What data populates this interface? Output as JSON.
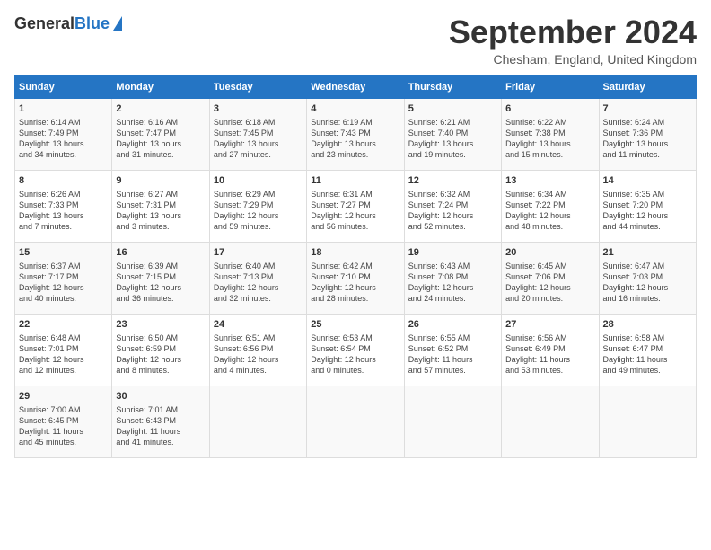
{
  "header": {
    "logo_general": "General",
    "logo_blue": "Blue",
    "month_title": "September 2024",
    "location": "Chesham, England, United Kingdom"
  },
  "days_of_week": [
    "Sunday",
    "Monday",
    "Tuesday",
    "Wednesday",
    "Thursday",
    "Friday",
    "Saturday"
  ],
  "weeks": [
    [
      {
        "day": "1",
        "info": "Sunrise: 6:14 AM\nSunset: 7:49 PM\nDaylight: 13 hours\nand 34 minutes."
      },
      {
        "day": "2",
        "info": "Sunrise: 6:16 AM\nSunset: 7:47 PM\nDaylight: 13 hours\nand 31 minutes."
      },
      {
        "day": "3",
        "info": "Sunrise: 6:18 AM\nSunset: 7:45 PM\nDaylight: 13 hours\nand 27 minutes."
      },
      {
        "day": "4",
        "info": "Sunrise: 6:19 AM\nSunset: 7:43 PM\nDaylight: 13 hours\nand 23 minutes."
      },
      {
        "day": "5",
        "info": "Sunrise: 6:21 AM\nSunset: 7:40 PM\nDaylight: 13 hours\nand 19 minutes."
      },
      {
        "day": "6",
        "info": "Sunrise: 6:22 AM\nSunset: 7:38 PM\nDaylight: 13 hours\nand 15 minutes."
      },
      {
        "day": "7",
        "info": "Sunrise: 6:24 AM\nSunset: 7:36 PM\nDaylight: 13 hours\nand 11 minutes."
      }
    ],
    [
      {
        "day": "8",
        "info": "Sunrise: 6:26 AM\nSunset: 7:33 PM\nDaylight: 13 hours\nand 7 minutes."
      },
      {
        "day": "9",
        "info": "Sunrise: 6:27 AM\nSunset: 7:31 PM\nDaylight: 13 hours\nand 3 minutes."
      },
      {
        "day": "10",
        "info": "Sunrise: 6:29 AM\nSunset: 7:29 PM\nDaylight: 12 hours\nand 59 minutes."
      },
      {
        "day": "11",
        "info": "Sunrise: 6:31 AM\nSunset: 7:27 PM\nDaylight: 12 hours\nand 56 minutes."
      },
      {
        "day": "12",
        "info": "Sunrise: 6:32 AM\nSunset: 7:24 PM\nDaylight: 12 hours\nand 52 minutes."
      },
      {
        "day": "13",
        "info": "Sunrise: 6:34 AM\nSunset: 7:22 PM\nDaylight: 12 hours\nand 48 minutes."
      },
      {
        "day": "14",
        "info": "Sunrise: 6:35 AM\nSunset: 7:20 PM\nDaylight: 12 hours\nand 44 minutes."
      }
    ],
    [
      {
        "day": "15",
        "info": "Sunrise: 6:37 AM\nSunset: 7:17 PM\nDaylight: 12 hours\nand 40 minutes."
      },
      {
        "day": "16",
        "info": "Sunrise: 6:39 AM\nSunset: 7:15 PM\nDaylight: 12 hours\nand 36 minutes."
      },
      {
        "day": "17",
        "info": "Sunrise: 6:40 AM\nSunset: 7:13 PM\nDaylight: 12 hours\nand 32 minutes."
      },
      {
        "day": "18",
        "info": "Sunrise: 6:42 AM\nSunset: 7:10 PM\nDaylight: 12 hours\nand 28 minutes."
      },
      {
        "day": "19",
        "info": "Sunrise: 6:43 AM\nSunset: 7:08 PM\nDaylight: 12 hours\nand 24 minutes."
      },
      {
        "day": "20",
        "info": "Sunrise: 6:45 AM\nSunset: 7:06 PM\nDaylight: 12 hours\nand 20 minutes."
      },
      {
        "day": "21",
        "info": "Sunrise: 6:47 AM\nSunset: 7:03 PM\nDaylight: 12 hours\nand 16 minutes."
      }
    ],
    [
      {
        "day": "22",
        "info": "Sunrise: 6:48 AM\nSunset: 7:01 PM\nDaylight: 12 hours\nand 12 minutes."
      },
      {
        "day": "23",
        "info": "Sunrise: 6:50 AM\nSunset: 6:59 PM\nDaylight: 12 hours\nand 8 minutes."
      },
      {
        "day": "24",
        "info": "Sunrise: 6:51 AM\nSunset: 6:56 PM\nDaylight: 12 hours\nand 4 minutes."
      },
      {
        "day": "25",
        "info": "Sunrise: 6:53 AM\nSunset: 6:54 PM\nDaylight: 12 hours\nand 0 minutes."
      },
      {
        "day": "26",
        "info": "Sunrise: 6:55 AM\nSunset: 6:52 PM\nDaylight: 11 hours\nand 57 minutes."
      },
      {
        "day": "27",
        "info": "Sunrise: 6:56 AM\nSunset: 6:49 PM\nDaylight: 11 hours\nand 53 minutes."
      },
      {
        "day": "28",
        "info": "Sunrise: 6:58 AM\nSunset: 6:47 PM\nDaylight: 11 hours\nand 49 minutes."
      }
    ],
    [
      {
        "day": "29",
        "info": "Sunrise: 7:00 AM\nSunset: 6:45 PM\nDaylight: 11 hours\nand 45 minutes."
      },
      {
        "day": "30",
        "info": "Sunrise: 7:01 AM\nSunset: 6:43 PM\nDaylight: 11 hours\nand 41 minutes."
      },
      {
        "day": "",
        "info": ""
      },
      {
        "day": "",
        "info": ""
      },
      {
        "day": "",
        "info": ""
      },
      {
        "day": "",
        "info": ""
      },
      {
        "day": "",
        "info": ""
      }
    ]
  ]
}
